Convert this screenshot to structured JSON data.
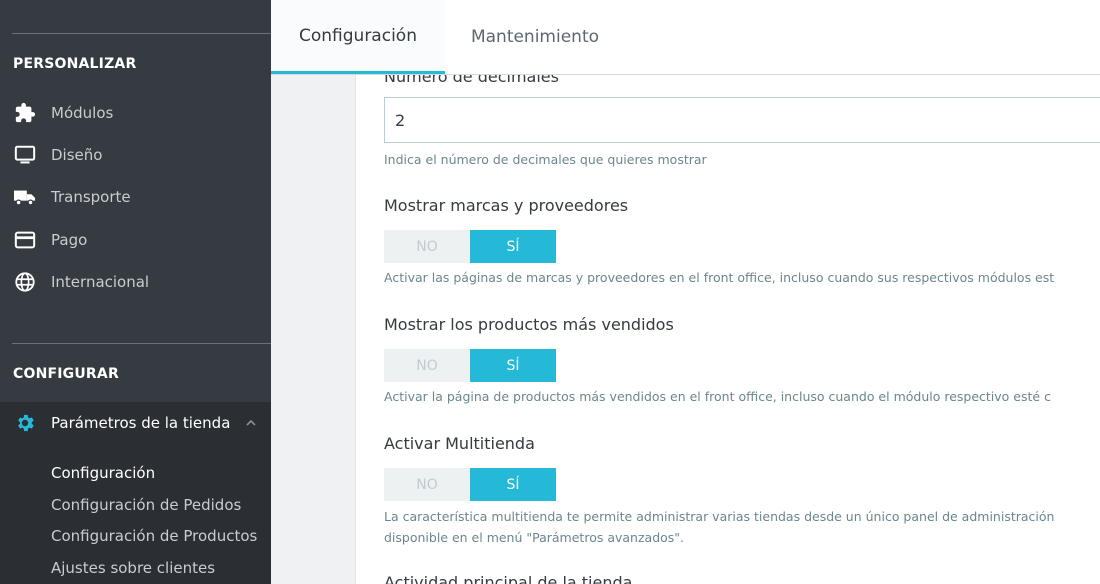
{
  "sidebar": {
    "section_personalizar": "PERSONALIZAR",
    "items": [
      {
        "label": "Módulos",
        "icon": "puzzle-icon"
      },
      {
        "label": "Diseño",
        "icon": "monitor-icon"
      },
      {
        "label": "Transporte",
        "icon": "truck-icon"
      },
      {
        "label": "Pago",
        "icon": "credit-card-icon"
      },
      {
        "label": "Internacional",
        "icon": "globe-icon"
      }
    ],
    "section_configurar": "CONFIGURAR",
    "active_item": {
      "label": "Parámetros de la tienda",
      "icon": "gear-icon"
    },
    "submenu": [
      {
        "label": "Configuración"
      },
      {
        "label": "Configuración de Pedidos"
      },
      {
        "label": "Configuración de Productos"
      },
      {
        "label": "Ajustes sobre clientes"
      }
    ]
  },
  "tabs": [
    {
      "label": "Configuración"
    },
    {
      "label": "Mantenimiento"
    }
  ],
  "form": {
    "decimals": {
      "label": "Número de decimales",
      "value": "2",
      "help": "Indica el número de decimales que quieres mostrar"
    },
    "brands": {
      "label": "Mostrar marcas y proveedores",
      "no": "NO",
      "yes": "SÍ",
      "selected": "SÍ",
      "help": "Activar las páginas de marcas y proveedores en el front office, incluso cuando sus respectivos módulos est"
    },
    "bestsellers": {
      "label": "Mostrar los productos más vendidos",
      "no": "NO",
      "yes": "SÍ",
      "selected": "SÍ",
      "help": "Activar la página de productos más vendidos en el front office, incluso cuando el módulo respectivo esté c"
    },
    "multistore": {
      "label": "Activar Multitienda",
      "no": "NO",
      "yes": "SÍ",
      "selected": "SÍ",
      "help_line1": "La característica multitienda te permite administrar varias tiendas desde un único panel de administración",
      "help_line2": "disponible en el menú \"Parámetros avanzados\"."
    },
    "main_activity": {
      "label": "Actividad principal de la tienda"
    }
  },
  "colors": {
    "sidebar_bg": "#363a41",
    "accent": "#25b9d7"
  }
}
